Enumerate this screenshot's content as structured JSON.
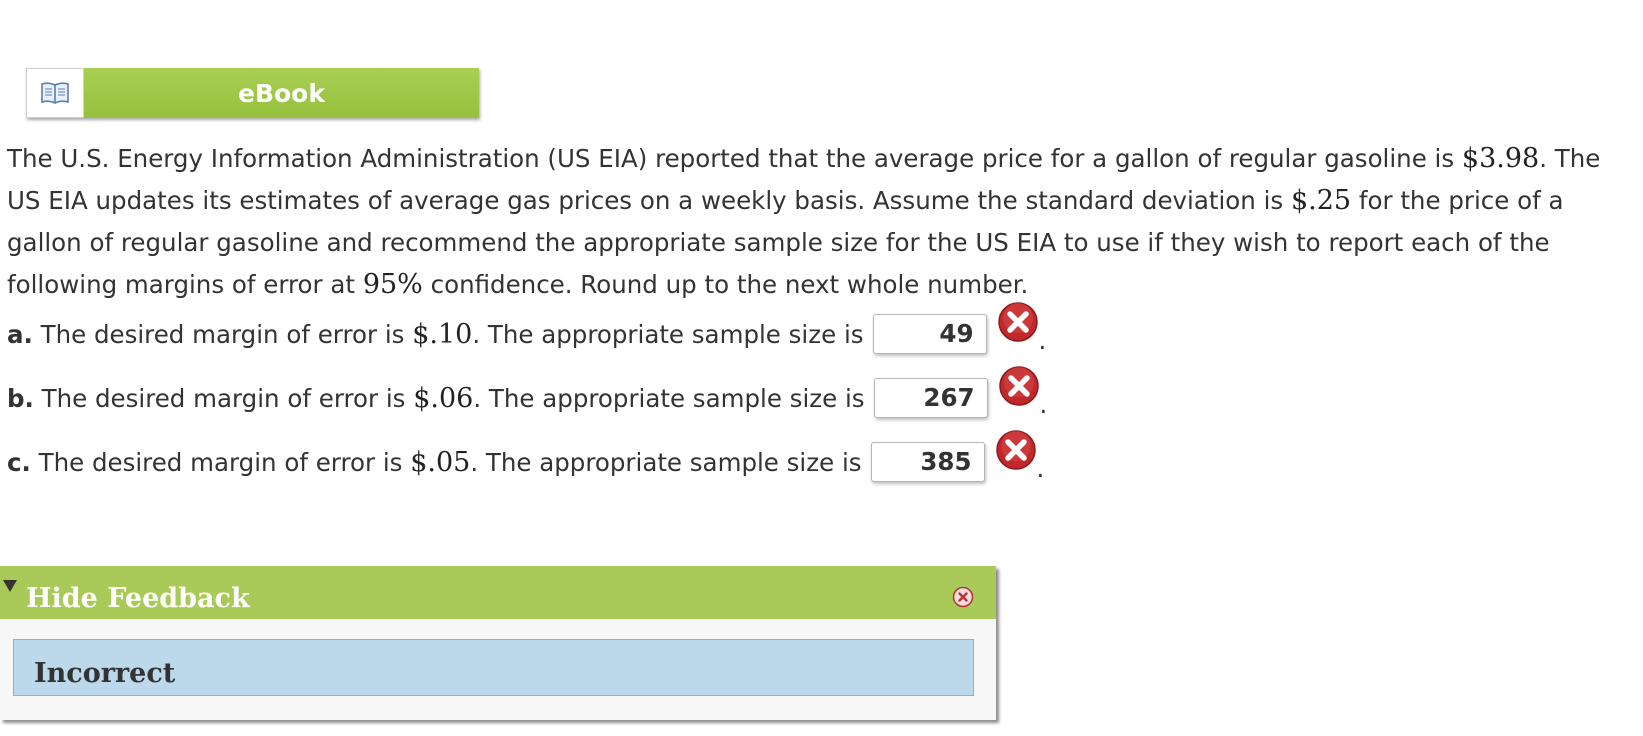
{
  "ebook": {
    "label": "eBook",
    "icon": "open-book-icon"
  },
  "question": {
    "text_1": "The U.S. Energy Information Administration (US EIA) reported that the average price for a gallon of regular gasoline is ",
    "price": "$3.98",
    "text_2": ". The US EIA updates its estimates of average gas prices on a weekly basis. Assume the standard deviation is ",
    "std_dev": "$.25",
    "text_3": " for the price of a gallon of regular gasoline and recommend the appropriate sample size for the US EIA to use if they wish to report each of the following margins of error at ",
    "confidence": "95%",
    "text_4": " confidence. Round up to the next whole number."
  },
  "parts": [
    {
      "letter": "a.",
      "text_before": " The desired margin of error is ",
      "margin": "$.10",
      "text_after": ". The appropriate sample size is",
      "answer": "49",
      "status_icon": "incorrect-x-icon"
    },
    {
      "letter": "b.",
      "text_before": " The desired margin of error is ",
      "margin": "$.06",
      "text_after": ". The appropriate sample size is",
      "answer": "267",
      "status_icon": "incorrect-x-icon"
    },
    {
      "letter": "c.",
      "text_before": " The desired margin of error is ",
      "margin": "$.05",
      "text_after": ". The appropriate sample size is",
      "answer": "385",
      "status_icon": "incorrect-x-icon"
    }
  ],
  "period": ".",
  "feedback": {
    "toggle_label": "Hide Feedback",
    "result": "Incorrect",
    "close_icon": "close-icon"
  },
  "colors": {
    "ebook_green": "#9ac544",
    "feedback_header": "#a9ca58",
    "feedback_body": "#bbd9eb",
    "error_red": "#c0282b"
  }
}
